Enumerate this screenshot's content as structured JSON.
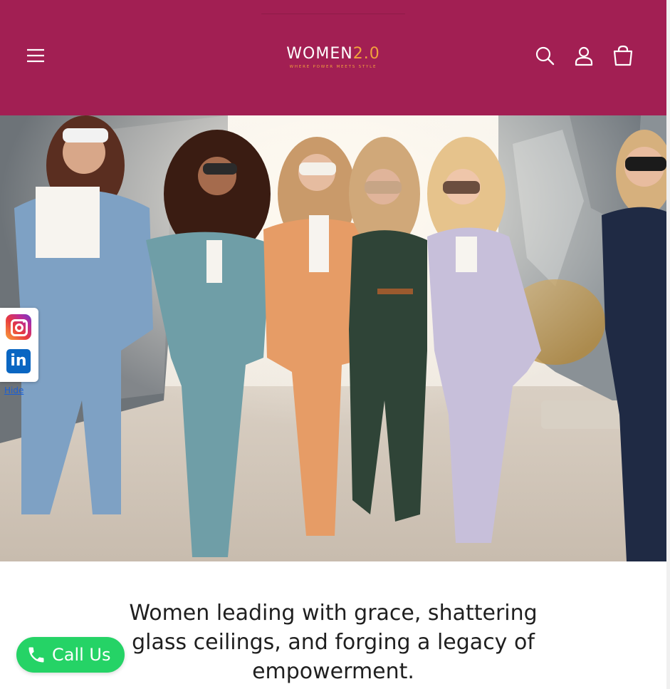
{
  "header": {
    "logo": {
      "text_main": "WOMEN",
      "text_accent": "2.0",
      "tagline": "WHERE POWER MEETS STYLE"
    },
    "icons": [
      "menu-icon",
      "search-icon",
      "account-icon",
      "cart-icon"
    ],
    "background_color": "#a21f53"
  },
  "social": {
    "icons": [
      "instagram-icon",
      "linkedin-icon"
    ],
    "linkedin_letters": "in",
    "hide_label": "Hide"
  },
  "main": {
    "tagline": "Women leading with grace, shattering glass ceilings, and forging a legacy of empowerment."
  },
  "call": {
    "label": "Call Us",
    "color": "#25d366"
  }
}
